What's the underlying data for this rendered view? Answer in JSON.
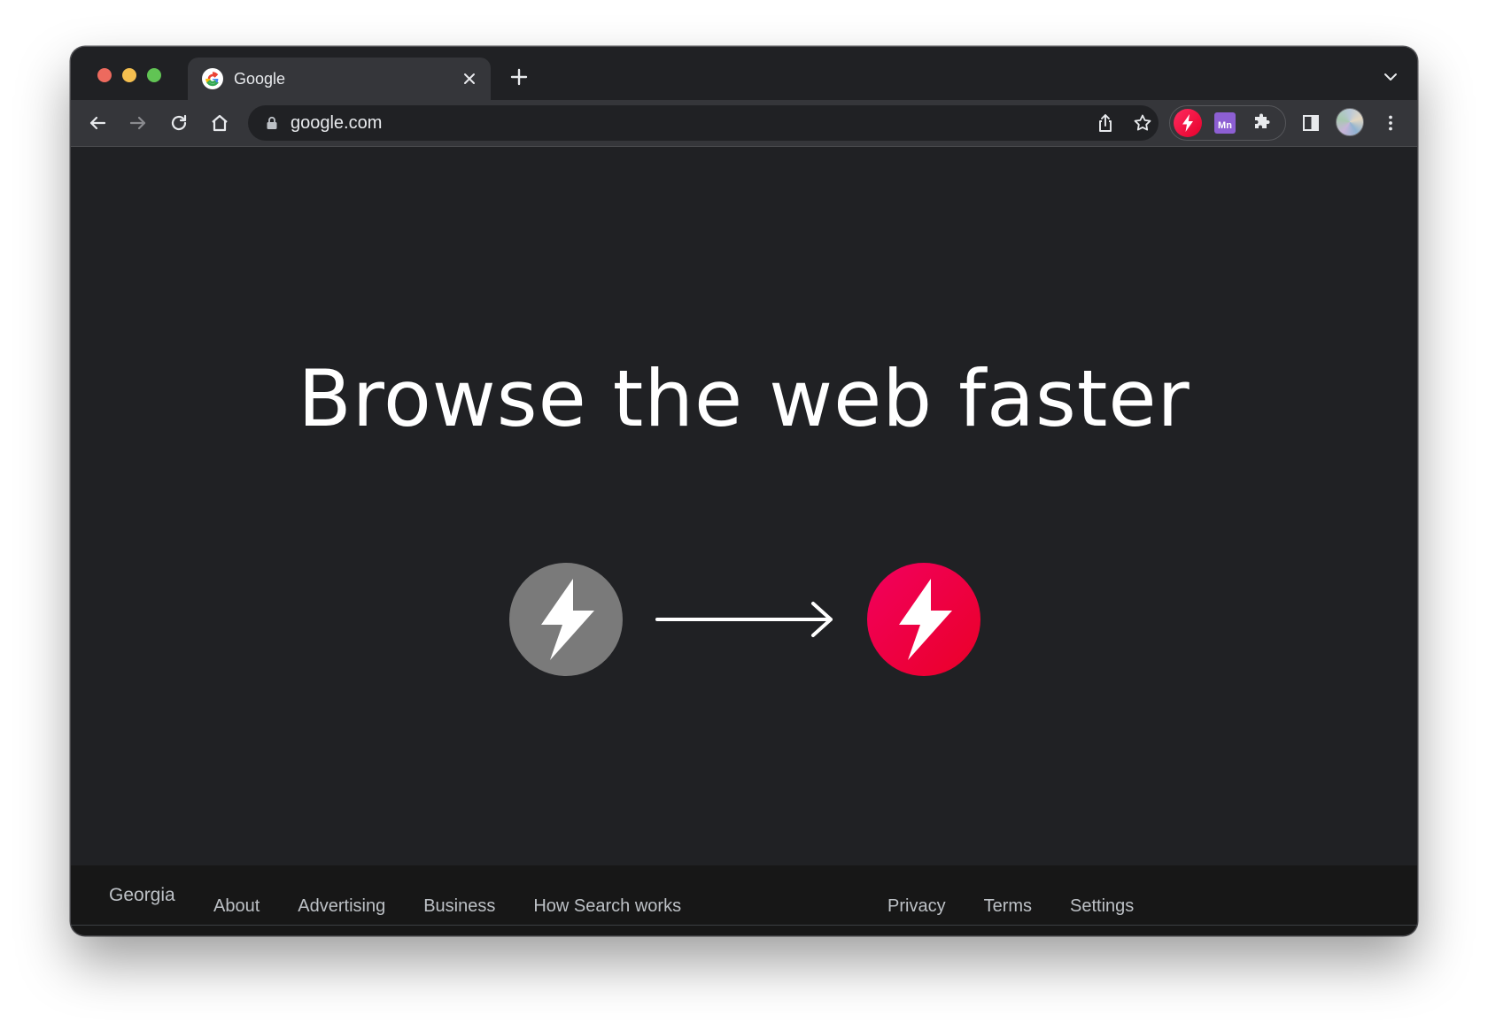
{
  "browser": {
    "tab_title": "Google",
    "url": "google.com",
    "extension_mn_label": "Mn"
  },
  "page": {
    "headline": "Browse the web faster",
    "accent_color": "#ea0027",
    "gray_circle_color": "#7a7a7a"
  },
  "footer": {
    "country": "Georgia",
    "left_links": [
      "About",
      "Advertising",
      "Business",
      "How Search works"
    ],
    "right_links": [
      "Privacy",
      "Terms",
      "Settings"
    ]
  },
  "icons": {
    "tab_favicon": "google-g-icon",
    "back": "arrow-left-icon",
    "forward": "arrow-right-icon",
    "reload": "reload-icon",
    "home": "home-icon",
    "lock": "lock-icon",
    "share": "share-icon",
    "bookmark": "star-icon",
    "extension_bolt": "bolt-icon",
    "extensions": "puzzle-icon",
    "side_panel": "side-panel-icon",
    "menu": "kebab-menu-icon"
  }
}
